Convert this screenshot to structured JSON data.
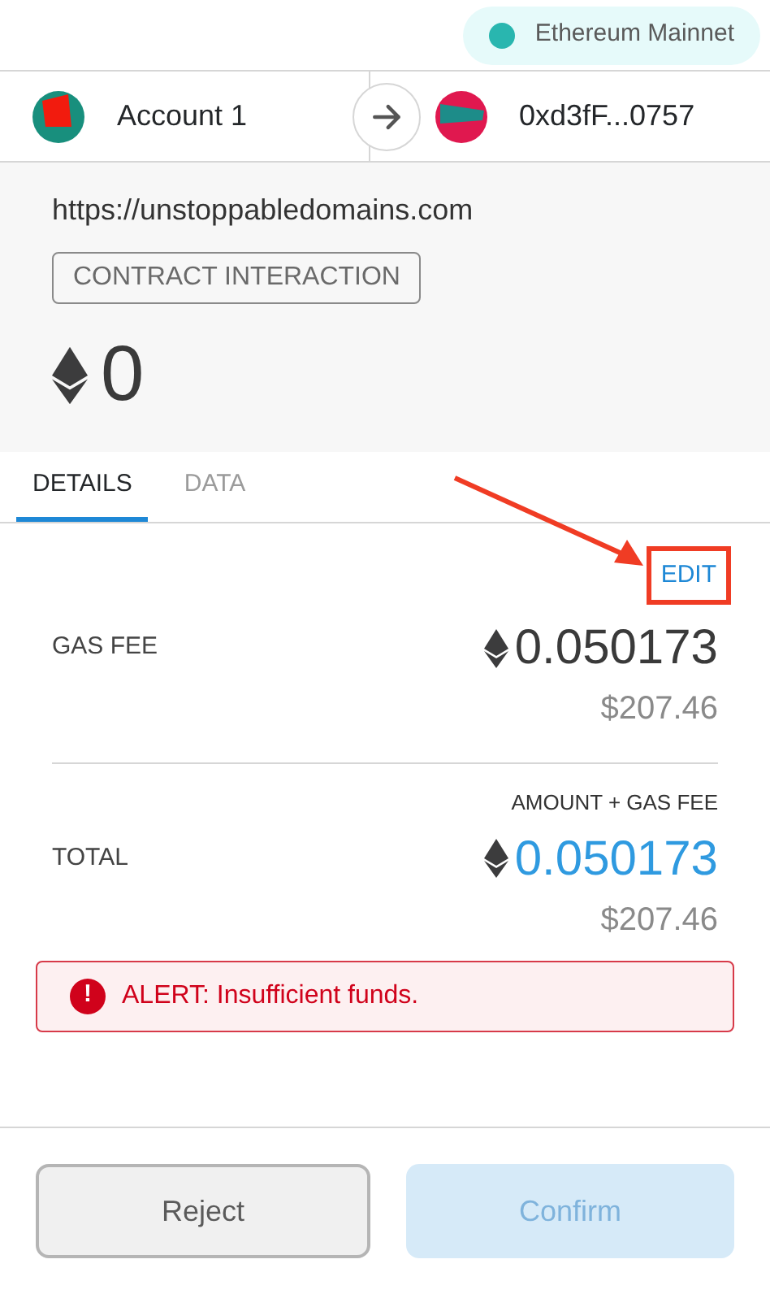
{
  "network": {
    "label": "Ethereum Mainnet",
    "color": "#29b6af"
  },
  "from": {
    "name": "Account 1"
  },
  "to": {
    "address": "0xd3fF...0757"
  },
  "origin": "https://unstoppabledomains.com",
  "action_badge": "CONTRACT INTERACTION",
  "amount": {
    "value": "0"
  },
  "tabs": [
    {
      "label": "DETAILS",
      "selected": true
    },
    {
      "label": "DATA",
      "selected": false
    }
  ],
  "edit": {
    "label": "EDIT",
    "highlighted": true
  },
  "rows": [
    {
      "kind": "gas",
      "label": "GAS FEE",
      "eth": "0.050173",
      "fiat": "$207.46"
    },
    {
      "kind": "total",
      "caption": "AMOUNT + GAS FEE",
      "label": "TOTAL",
      "eth": "0.050173",
      "fiat": "$207.46"
    }
  ],
  "alert": {
    "icon": "!",
    "text": "ALERT: Insufficient funds."
  },
  "buttons": [
    {
      "label": "Reject",
      "disabled": false,
      "kind": "secondary"
    },
    {
      "label": "Confirm",
      "disabled": true,
      "kind": "primary"
    }
  ]
}
